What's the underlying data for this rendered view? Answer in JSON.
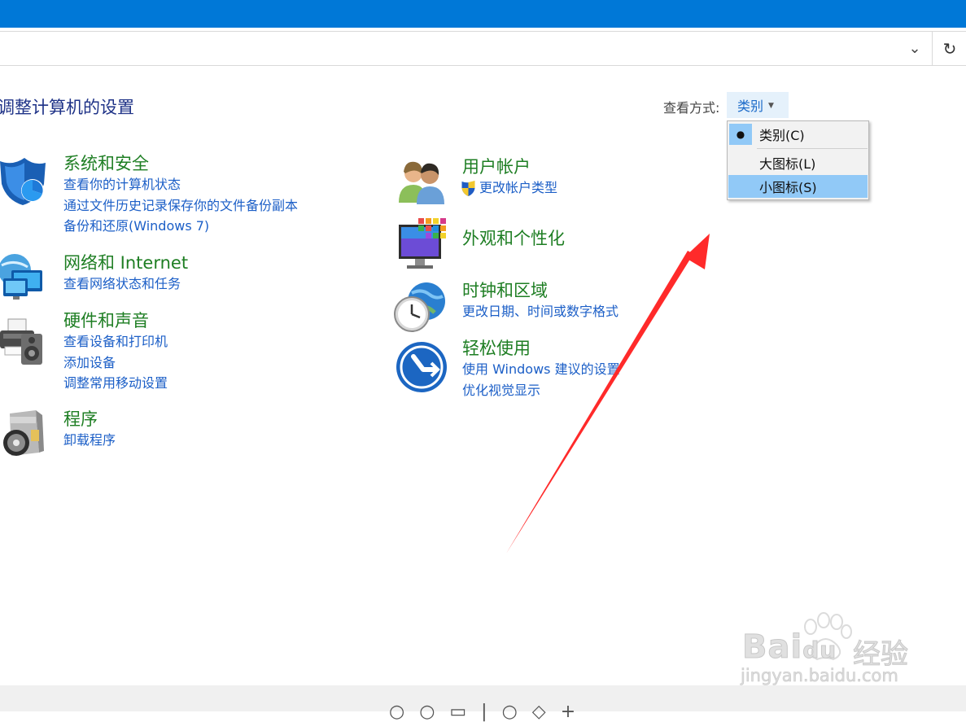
{
  "header": {
    "page_title": "调整计算机的设置",
    "address_dropdown_icon": "chevron-down-icon",
    "refresh_icon": "refresh-icon"
  },
  "view_by": {
    "label": "查看方式:",
    "current": "类别",
    "menu": {
      "items": [
        "类别(C)",
        "大图标(L)",
        "小图标(S)"
      ],
      "checked": "类别(C)",
      "highlighted": "小图标(S)"
    }
  },
  "categories_left": [
    {
      "title": "系统和安全",
      "links": [
        "查看你的计算机状态",
        "通过文件历史记录保存你的文件备份副本",
        "备份和还原(Windows 7)"
      ]
    },
    {
      "title": "网络和 Internet",
      "links": [
        "查看网络状态和任务"
      ]
    },
    {
      "title": "硬件和声音",
      "links": [
        "查看设备和打印机",
        "添加设备",
        "调整常用移动设置"
      ]
    },
    {
      "title": "程序",
      "links": [
        "卸载程序"
      ]
    }
  ],
  "categories_right": [
    {
      "title": "用户帐户",
      "links": [
        "更改帐户类型"
      ]
    },
    {
      "title": "外观和个性化",
      "links": []
    },
    {
      "title": "时钟和区域",
      "links": [
        "更改日期、时间或数字格式"
      ]
    },
    {
      "title": "轻松使用",
      "links": [
        "使用 Windows 建议的设置",
        "优化视觉显示"
      ]
    }
  ],
  "watermark": {
    "brand": "Bai",
    "brand2": "du",
    "cn": "经验",
    "url": "jingyan.baidu.com"
  },
  "colors": {
    "accent": "#0078d7",
    "category_title": "#1e7e23",
    "link": "#1c5fc7",
    "menu_highlight": "#91c9f7",
    "annotation_arrow": "#ff2a2a"
  }
}
